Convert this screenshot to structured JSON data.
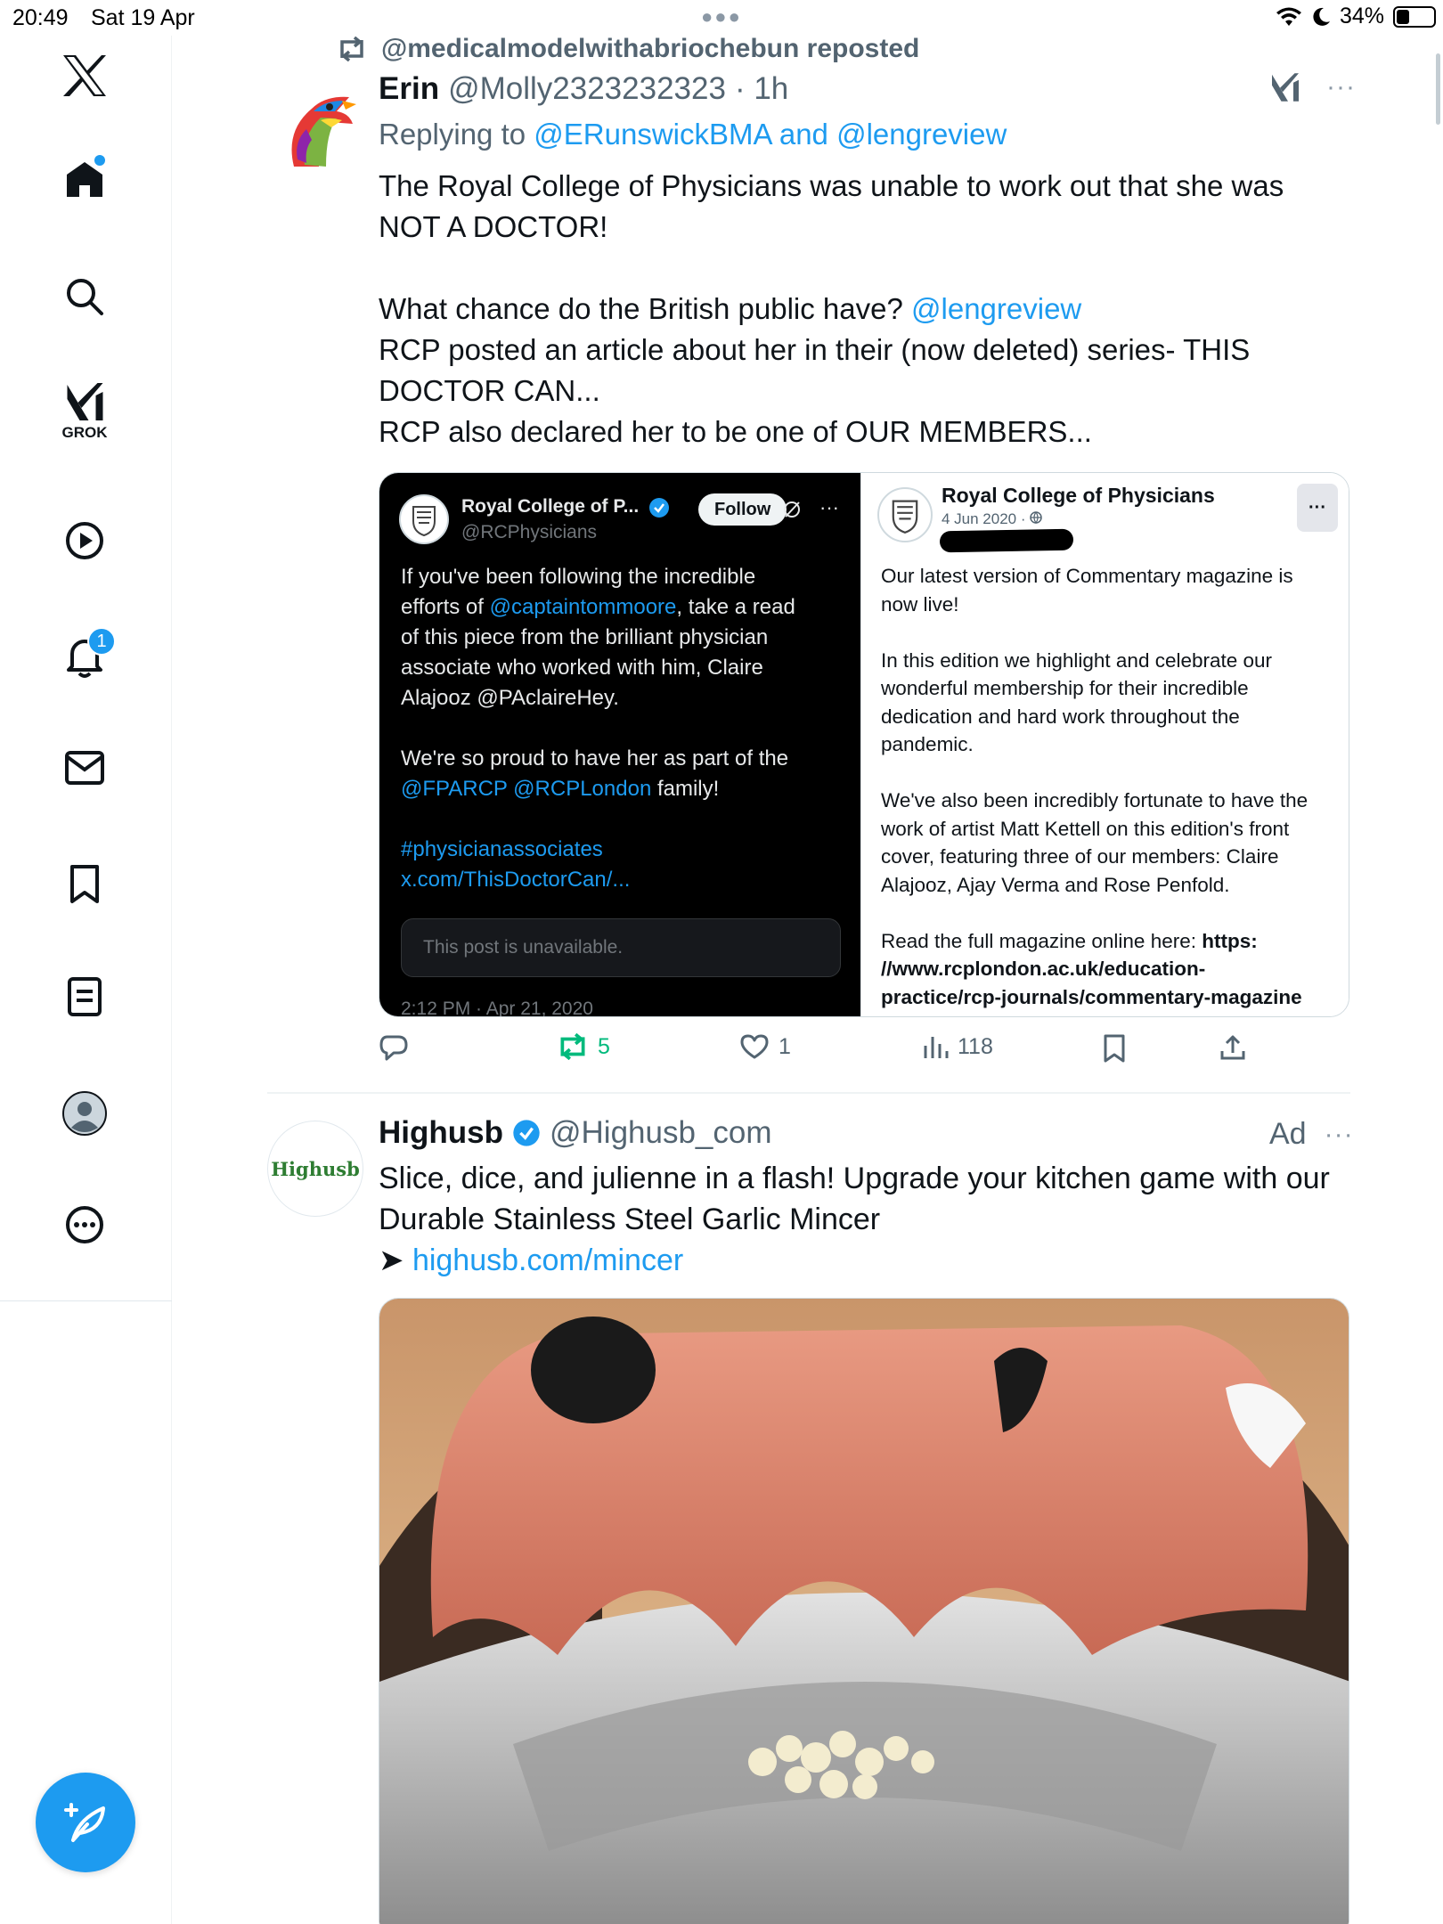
{
  "status_bar": {
    "time": "20:49",
    "date": "Sat 19 Apr",
    "battery_text": "34%",
    "battery_level": 0.34
  },
  "sidebar": {
    "grok_label": "GROK",
    "notifications_count": "1",
    "items": [
      "x-logo",
      "home-icon",
      "search-icon",
      "grok-icon",
      "video-icon",
      "notifications-icon",
      "messages-icon",
      "bookmarks-icon",
      "lists-icon",
      "profile-icon",
      "more-icon"
    ]
  },
  "tweet1": {
    "repost_by": "@medicalmodelwithabriochebun reposted",
    "name": "Erin",
    "handle": "@Molly2323232323",
    "time": "· 1h",
    "reply_prefix": "Replying to ",
    "reply_to_1": "@ERunswickBMA",
    "reply_and": " and ",
    "reply_to_2": "@lengreview",
    "body_1": "The Royal College of Physicians was unable to work out that she was\nNOT A DOCTOR!",
    "body_2_pre": "What chance do the British public have? ",
    "body_2_link": "@lengreview",
    "body_3": "RCP posted an article about her in their (now deleted) series- THIS\nDOCTOR CAN...\nRCP also declared her to be one of OUR MEMBERS...",
    "embed_left": {
      "name": "Royal College of P...",
      "handle": "@RCPhysicians",
      "follow": "Follow",
      "text_1": "If you've been following the incredible\nefforts of ",
      "text_link_1": "@captaintommoore",
      "text_2": ", take a read\nof this piece from the brilliant physician\nassociate who worked with him, Claire\nAlajooz @PAclaireHey.\n\nWe're so proud to have her as part of the\n",
      "text_link_2": "@FPARCP @RCPLondon",
      "text_3": " family!\n\n",
      "text_link_3": "#physicianassociates\nx.com/ThisDoctorCan/...",
      "unavailable": "This post is unavailable.",
      "timestamp": "2:12 PM · Apr 21, 2020"
    },
    "embed_right": {
      "name": "Royal College of Physicians",
      "date": "4 Jun 2020 · ",
      "more": "···",
      "text_1": "Our latest version of Commentary magazine is\nnow live!\n\nIn this edition we highlight and celebrate our\nwonderful membership for their incredible\ndedication and hard work throughout the\npandemic.\n\nWe've also been incredibly fortunate to have the\nwork of artist Matt Kettell on this edition's front\ncover, featuring three of our members: Claire\nAlajooz, Ajay Verma and Rose Penfold.\n\nRead the full magazine online here: ",
      "text_bold": "https:\n//www.rcplondon.ac.uk/education-\npractice/rcp-journals/commentary-magazine"
    },
    "actions": {
      "replies": "",
      "reposts": "5",
      "likes": "1",
      "views": "118"
    }
  },
  "ad_tweet": {
    "avatar_text": "Highusb",
    "name": "Highusb",
    "handle": "@Highusb_com",
    "ad_label": "Ad",
    "body": "Slice, dice, and julienne in a flash! Upgrade your kitchen game with our\nDurable Stainless Steel Garlic Mincer",
    "arrow": "➤ ",
    "link": "highusb.com/mincer"
  },
  "colors": {
    "accent": "#1d9bf0",
    "repost_green": "#00ba7c",
    "secondary_text": "#536471"
  }
}
